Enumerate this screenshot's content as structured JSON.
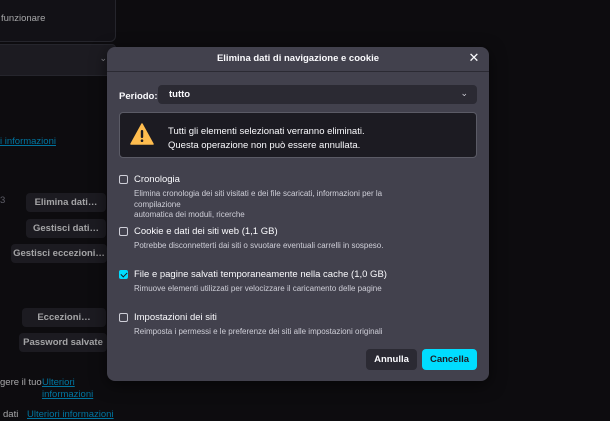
{
  "background": {
    "box_text": "funzionare",
    "link_more_info": "i informazioni",
    "btn_delete_data": "Elimina dati…",
    "btn_manage_data": "Gestisci dati…",
    "btn_manage_exceptions": "Gestisci eccezioni…",
    "btn_exceptions": "Eccezioni…",
    "btn_saved_passwords": "Password salvate",
    "small_num": "3",
    "text_bottom1": "gere il tuo",
    "link_bottom1_a": "Ulteriori",
    "link_bottom1_b": "informazioni",
    "text_bottom2": "dati",
    "link_bottom2": "Ulteriori informazioni"
  },
  "dialog": {
    "title": "Elimina dati di navigazione e cookie",
    "close_icon": "close-icon",
    "period_label": "Periodo:",
    "period_value": "tutto",
    "warning_line1": "Tutti gli elementi selezionati verranno eliminati.",
    "warning_line2": "Questa operazione non può essere annullata.",
    "options": [
      {
        "label": "Cronologia",
        "desc_line1": "Elimina cronologia dei siti visitati e dei file scaricati, informazioni per la compilazione",
        "desc_line2": "automatica dei moduli, ricerche",
        "checked": false
      },
      {
        "label": "Cookie e dati dei siti web (1,1 GB)",
        "desc_line1": "Potrebbe disconnetterti dai siti o svuotare eventuali carrelli in sospeso.",
        "checked": false
      },
      {
        "label": "File e pagine salvati temporaneamente nella cache (1,0 GB)",
        "desc_line1": "Rimuove elementi utilizzati per velocizzare il caricamento delle pagine",
        "checked": true
      },
      {
        "label": "Impostazioni dei siti",
        "desc_line1": "Reimposta i permessi e le preferenze dei siti alle impostazioni originali",
        "checked": false
      }
    ],
    "btn_cancel": "Annulla",
    "btn_confirm": "Cancella"
  },
  "colors": {
    "accent": "#00ddff",
    "link": "#00b3f4",
    "dialog_bg": "#42414d",
    "page_bg": "#141318",
    "warning": "#ffbd4f"
  }
}
